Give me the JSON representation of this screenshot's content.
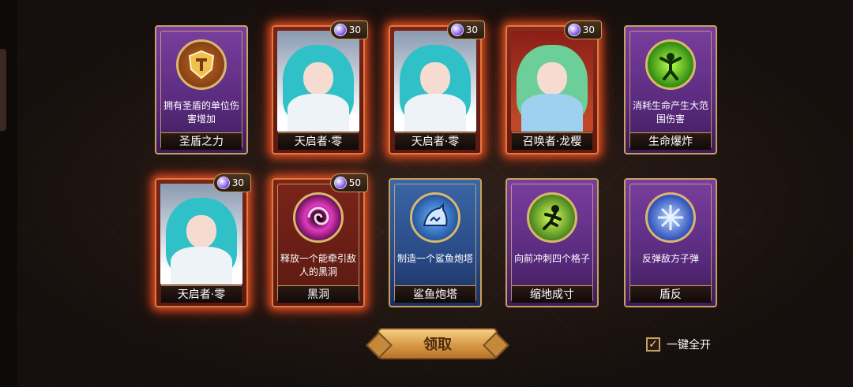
{
  "cards": [
    {
      "type": "skill",
      "name": "圣盾之力",
      "desc": "拥有圣盾的单位伤害增加",
      "icon": "shield-icon",
      "cost": null
    },
    {
      "type": "hero",
      "name": "天启者·零",
      "cost": "30"
    },
    {
      "type": "hero",
      "name": "天启者·零",
      "cost": "30"
    },
    {
      "type": "summon",
      "name": "召唤者·龙樱",
      "cost": "30"
    },
    {
      "type": "skill",
      "name": "生命爆炸",
      "desc": "消耗生命产生大范围伤害",
      "icon": "explosion-icon",
      "cost": null
    },
    {
      "type": "hero",
      "name": "天启者·零",
      "cost": "30"
    },
    {
      "type": "skill",
      "name": "黑洞",
      "desc": "释放一个能牵引敌人的黑洞",
      "icon": "black-hole-icon",
      "cost": "50"
    },
    {
      "type": "skill",
      "name": "鲨鱼炮塔",
      "desc": "制造一个鲨鱼炮塔",
      "icon": "shark-icon",
      "cost": null
    },
    {
      "type": "skill",
      "name": "缩地成寸",
      "desc": "向前冲刺四个格子",
      "icon": "dash-icon",
      "cost": null
    },
    {
      "type": "skill",
      "name": "盾反",
      "desc": "反弹敌方子弹",
      "icon": "reflect-icon",
      "cost": null
    }
  ],
  "buttons": {
    "claim": "领取"
  },
  "options": {
    "open_all_label": "一键全开",
    "open_all_checked": true,
    "checkmark": "✓"
  },
  "colors": {
    "skill_purple": "#6a3490",
    "skill_blue": "#2f548f",
    "hero_red": "#7b2419",
    "glow": "#ff5a28",
    "gold": "#c8a060"
  }
}
